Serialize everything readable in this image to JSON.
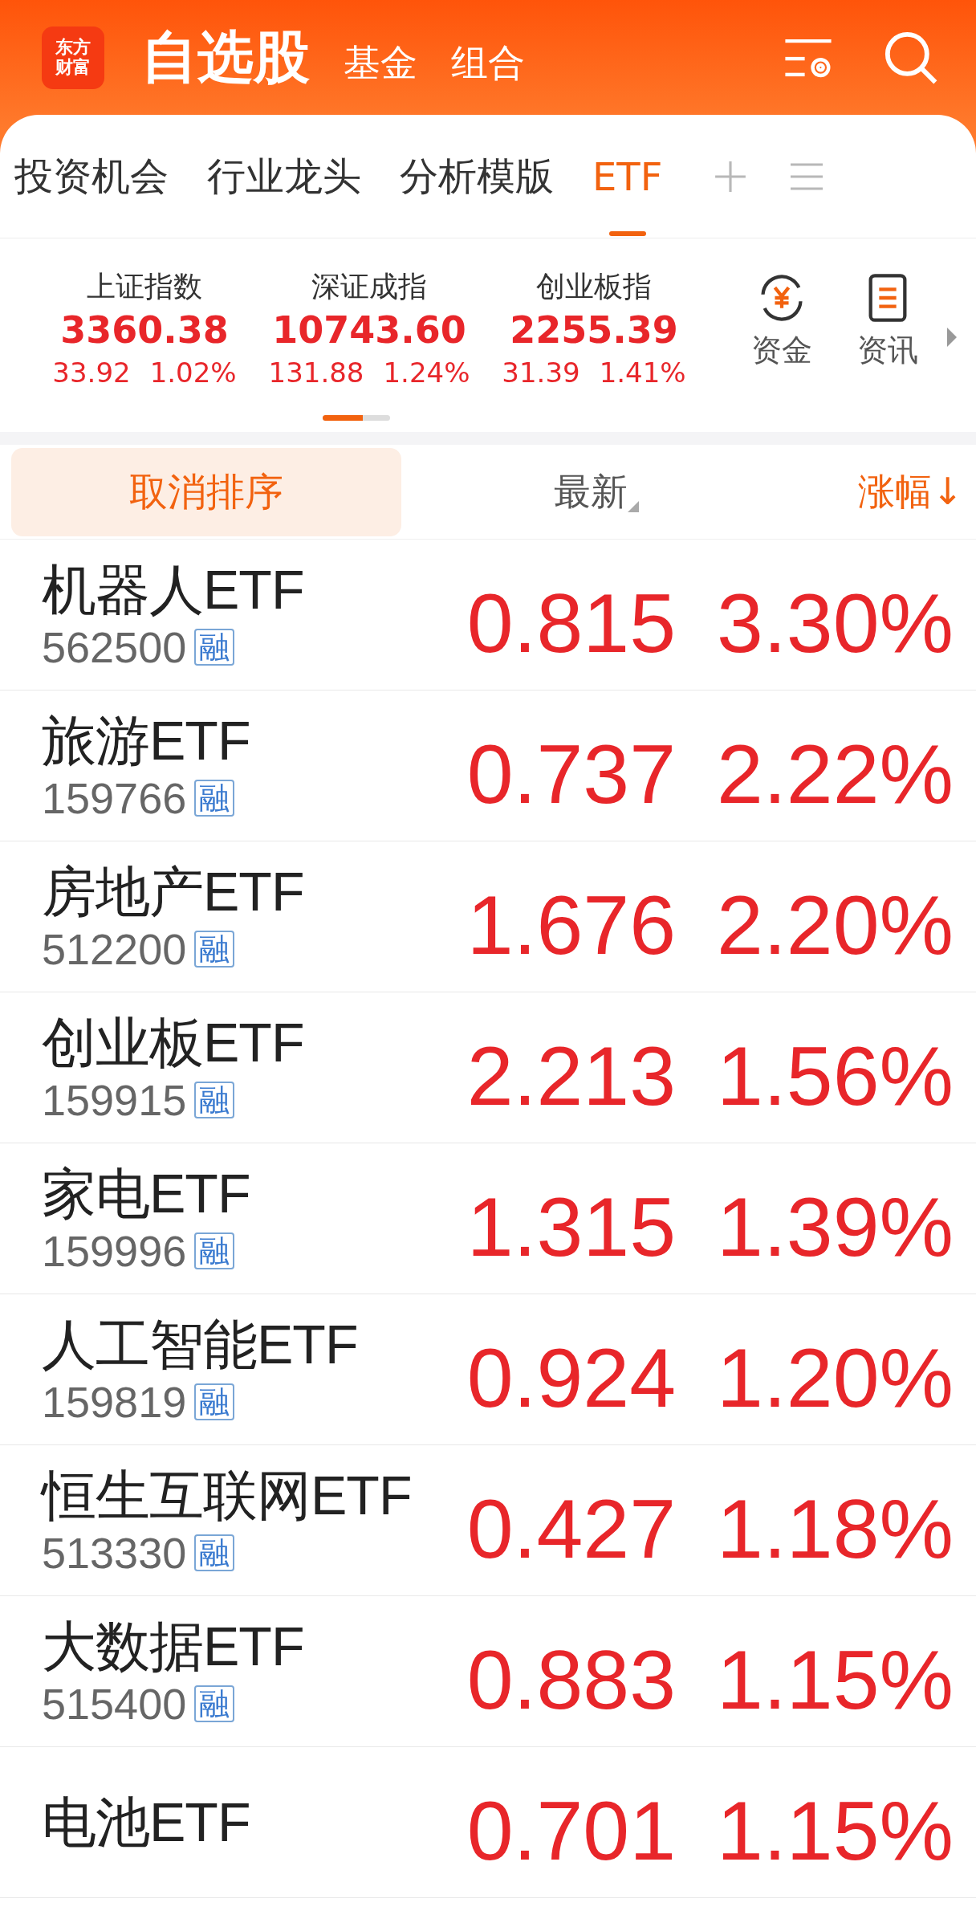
{
  "header": {
    "logo": [
      "东方",
      "财富"
    ],
    "nav": [
      {
        "label": "自选股",
        "selected": true
      },
      {
        "label": "基金",
        "selected": false
      },
      {
        "label": "组合",
        "selected": false
      }
    ]
  },
  "tabs": [
    {
      "label": "投资机会",
      "selected": false
    },
    {
      "label": "行业龙头",
      "selected": false
    },
    {
      "label": "分析模版",
      "selected": false
    },
    {
      "label": "ETF",
      "selected": true
    }
  ],
  "indices": [
    {
      "name": "上证指数",
      "value": "3360.38",
      "change": "33.92",
      "percent": "1.02%"
    },
    {
      "name": "深证成指",
      "value": "10743.60",
      "change": "131.88",
      "percent": "1.24%"
    },
    {
      "name": "创业板指",
      "value": "2255.39",
      "change": "31.39",
      "percent": "1.41%"
    }
  ],
  "shortcuts": [
    {
      "label": "资金",
      "kind": "fund"
    },
    {
      "label": "资讯",
      "kind": "news"
    }
  ],
  "sort_bar": {
    "cancel": "取消排序",
    "columns": [
      {
        "label": "最新",
        "sorted": false
      },
      {
        "label": "涨幅↓",
        "sorted": true
      }
    ]
  },
  "rows": [
    {
      "name": "机器人ETF",
      "code": "562500",
      "badge": "融",
      "price": "0.815",
      "change": "3.30%"
    },
    {
      "name": "旅游ETF",
      "code": "159766",
      "badge": "融",
      "price": "0.737",
      "change": "2.22%"
    },
    {
      "name": "房地产ETF",
      "code": "512200",
      "badge": "融",
      "price": "1.676",
      "change": "2.20%"
    },
    {
      "name": "创业板ETF",
      "code": "159915",
      "badge": "融",
      "price": "2.213",
      "change": "1.56%"
    },
    {
      "name": "家电ETF",
      "code": "159996",
      "badge": "融",
      "price": "1.315",
      "change": "1.39%"
    },
    {
      "name": "人工智能ETF",
      "code": "159819",
      "badge": "融",
      "price": "0.924",
      "change": "1.20%"
    },
    {
      "name": "恒生互联网ETF",
      "code": "513330",
      "badge": "融",
      "price": "0.427",
      "change": "1.18%"
    },
    {
      "name": "大数据ETF",
      "code": "515400",
      "badge": "融",
      "price": "0.883",
      "change": "1.15%"
    },
    {
      "name": "电池ETF",
      "price": "0.701",
      "change": "1.15%"
    }
  ]
}
